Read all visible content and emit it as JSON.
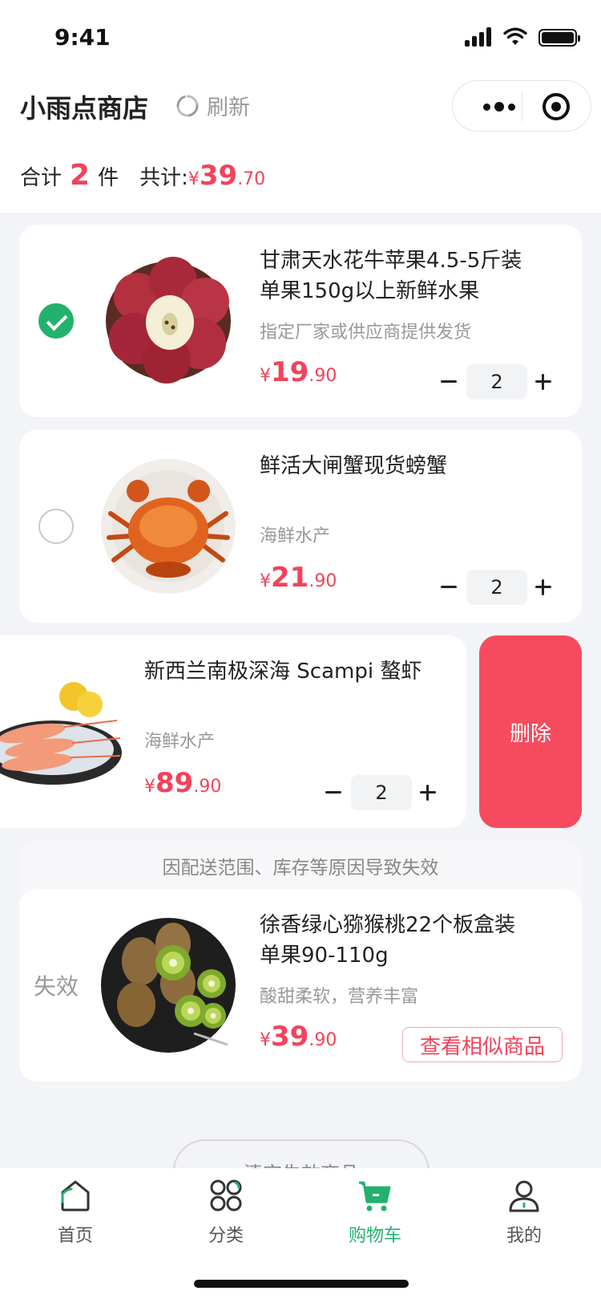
{
  "status_bar": {
    "time": "9:41"
  },
  "header": {
    "shop_name": "小雨点商店",
    "refresh_label": "刷新"
  },
  "summary": {
    "count_prefix": "合计",
    "count": "2",
    "count_unit": "件",
    "total_label": "共计:",
    "currency": "¥",
    "total_int": "39",
    "total_dec": ".70"
  },
  "cart_items": [
    {
      "title_line1": "甘肃天水花牛苹果4.5-5斤装",
      "title_line2": "单果150g以上新鲜水果",
      "desc": "指定厂家或供应商提供发货",
      "price_int": "19",
      "price_dec": ".90",
      "qty": "2",
      "checked": true,
      "image": "apples"
    },
    {
      "title_line1": "鲜活大闸蟹现货螃蟹",
      "title_line2": "",
      "desc": "海鲜水产",
      "price_int": "21",
      "price_dec": ".90",
      "qty": "2",
      "checked": false,
      "image": "crab"
    },
    {
      "title_line1": "新西兰南极深海 Scampi 螯虾",
      "title_line2": "",
      "desc": "海鲜水产",
      "price_int": "89",
      "price_dec": ".90",
      "qty": "2",
      "checked": false,
      "image": "scampi",
      "swiped": true
    }
  ],
  "delete_label": "删除",
  "invalid_section": {
    "note": "因配送范围、库存等原因导致失效",
    "tag": "失效",
    "item": {
      "title_line1": "徐香绿心猕猴桃22个板盒装",
      "title_line2": "单果90-110g",
      "desc": "酸甜柔软，营养丰富",
      "price_int": "39",
      "price_dec": ".90",
      "action": "查看相似商品",
      "image": "kiwi"
    }
  },
  "clear_invalid_label": "清空失效商品",
  "tabs": [
    {
      "label": "首页",
      "icon": "home-icon"
    },
    {
      "label": "分类",
      "icon": "category-icon"
    },
    {
      "label": "购物车",
      "icon": "cart-icon",
      "active": true
    },
    {
      "label": "我的",
      "icon": "user-icon"
    }
  ],
  "colors": {
    "accent_red": "#f2435b",
    "delete_red": "#f64b5e",
    "brand_green": "#23b26d"
  }
}
